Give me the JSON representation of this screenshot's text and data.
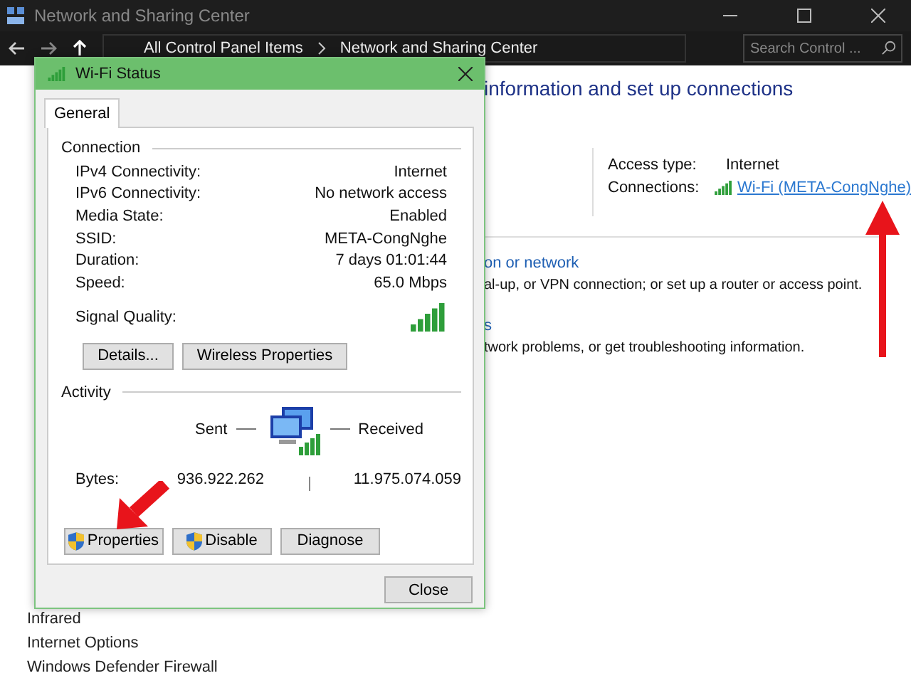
{
  "window": {
    "title": "Network and Sharing Center"
  },
  "address_bar": {
    "path": [
      "All Control Panel Items",
      "Network and Sharing Center"
    ],
    "search_placeholder": "Search Control ..."
  },
  "main": {
    "heading": "information and set up connections",
    "access_type_label": "Access type:",
    "access_type": "Internet",
    "connections_label": "Connections:",
    "connection_link": "Wi-Fi (META-CongNghe)",
    "tasks": [
      {
        "link": "on or network",
        "description": "al-up, or VPN connection; or set up a router or access point."
      },
      {
        "link": "s",
        "description": "twork problems, or get troubleshooting information."
      }
    ]
  },
  "sidebar": {
    "items": [
      "Infrared",
      "Internet Options",
      "Windows Defender Firewall"
    ]
  },
  "dialog": {
    "title": "Wi-Fi Status",
    "tabs": [
      {
        "label": "General",
        "selected": true
      }
    ],
    "connection_group": "Connection",
    "fields": [
      {
        "label": "IPv4 Connectivity:",
        "value": "Internet"
      },
      {
        "label": "IPv6 Connectivity:",
        "value": "No network access"
      },
      {
        "label": "Media State:",
        "value": "Enabled"
      },
      {
        "label": "SSID:",
        "value": "META-CongNghe"
      },
      {
        "label": "Duration:",
        "value": "7 days 01:01:44"
      },
      {
        "label": "Speed:",
        "value": "65.0 Mbps"
      }
    ],
    "signal_label": "Signal Quality:",
    "connection_buttons": [
      "Details...",
      "Wireless Properties"
    ],
    "activity_group": "Activity",
    "sent_label": "Sent",
    "received_label": "Received",
    "bytes_label": "Bytes:",
    "bytes_sent": "936.922.262",
    "bytes_received": "11.975.074.059",
    "activity_buttons": [
      {
        "label": "Properties",
        "shield": true
      },
      {
        "label": "Disable",
        "shield": true
      },
      {
        "label": "Diagnose",
        "shield": false
      }
    ],
    "close_button": "Close"
  }
}
